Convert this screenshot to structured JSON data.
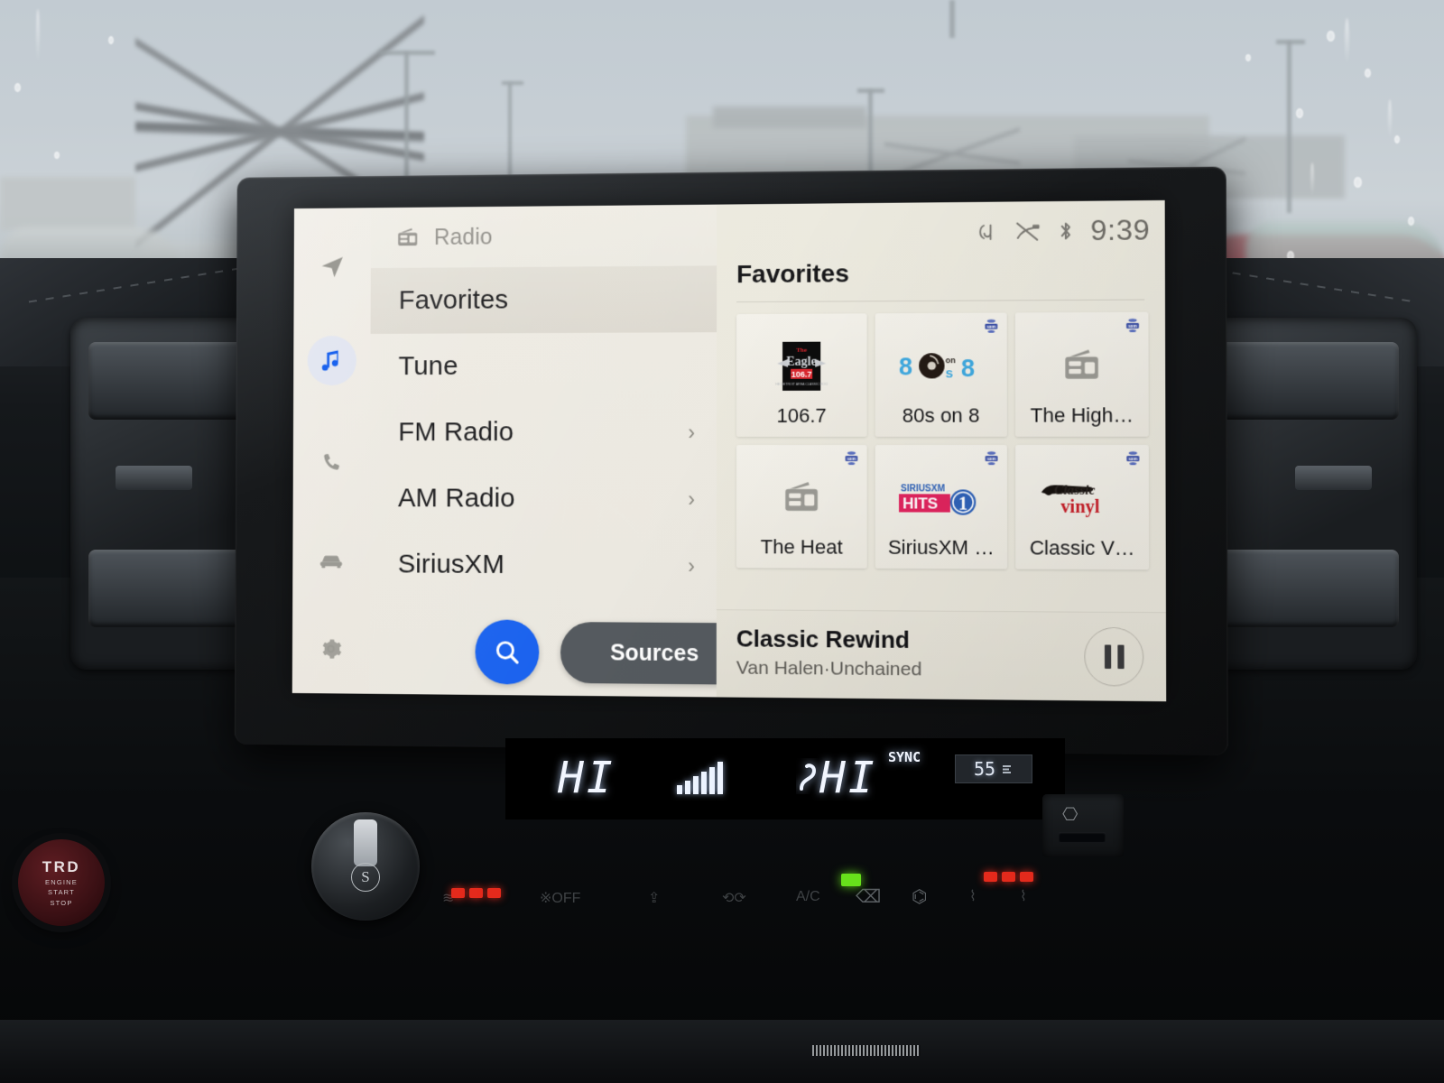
{
  "screen": {
    "header": {
      "icon": "radio-icon",
      "title": "Radio"
    },
    "status": {
      "icons": [
        "qi-wireless-charging-icon",
        "voice-muted-icon",
        "bluetooth-icon"
      ],
      "clock": "9:39"
    },
    "menu": [
      {
        "label": "Favorites",
        "selected": true,
        "chevron": ""
      },
      {
        "label": "Tune",
        "selected": false,
        "chevron": ""
      },
      {
        "label": "FM Radio",
        "selected": false,
        "chevron": "›"
      },
      {
        "label": "AM Radio",
        "selected": false,
        "chevron": "›"
      },
      {
        "label": "SiriusXM",
        "selected": false,
        "chevron": "›"
      }
    ],
    "search_button": {
      "icon": "search-icon"
    },
    "sources_button": {
      "label": "Sources"
    },
    "favorites": {
      "title": "Favorites",
      "tiles": [
        {
          "label": "106.7",
          "art": "eagle-1067-logo",
          "sxm": false
        },
        {
          "label": "80s on 8",
          "art": "80s-on-8-logo",
          "sxm": true
        },
        {
          "label": "The High…",
          "art": "generic-radio-icon",
          "sxm": true
        },
        {
          "label": "The Heat",
          "art": "generic-radio-icon",
          "sxm": true
        },
        {
          "label": "SiriusXM …",
          "art": "siriusxm-hits-1-logo",
          "sxm": true
        },
        {
          "label": "Classic V…",
          "art": "classic-vinyl-logo",
          "sxm": true
        }
      ]
    },
    "now_playing": {
      "title": "Classic Rewind",
      "subtitle": "Van Halen·Unchained",
      "transport": "pause-button"
    },
    "colors": {
      "accent_blue": "#1a62ee",
      "sources_gray": "#555a5f",
      "screen_bg": "#f2efe8",
      "selected_row": "#e2dfd6"
    }
  },
  "climate": {
    "left_temp": "HI",
    "right_temp": "HI",
    "sync_label": "SYNC",
    "outside_temp": "55",
    "fan_bars": 6
  },
  "console": {
    "start_button": {
      "brand": "TRD",
      "line1": "ENGINE",
      "line2": "START",
      "line3": "STOP"
    },
    "volume_knob": "volume-knob",
    "usb_port": "usb-icon"
  }
}
